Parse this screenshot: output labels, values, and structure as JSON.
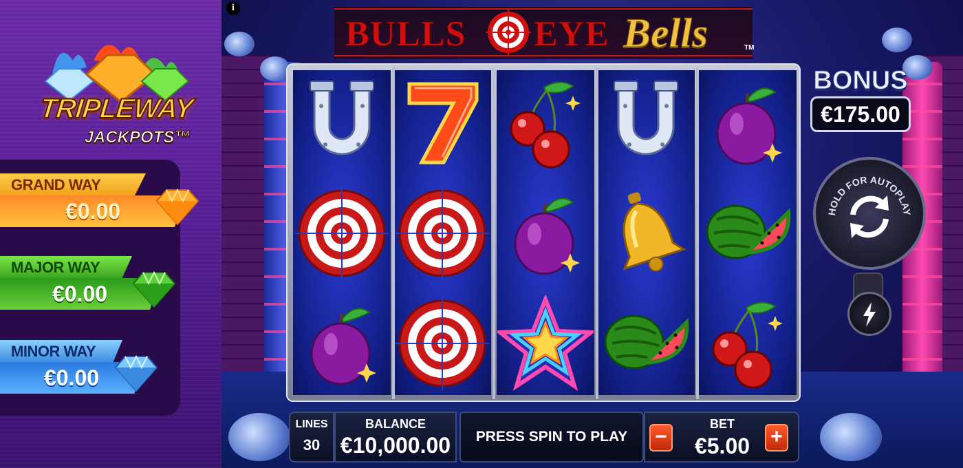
{
  "jackpots": {
    "logo_title": "TRIPLEWAY",
    "logo_sub": "JACKPOTS™",
    "grand": {
      "label": "GRAND WAY",
      "value": "€0.00"
    },
    "major": {
      "label": "MAJOR WAY",
      "value": "€0.00"
    },
    "minor": {
      "label": "MINOR WAY",
      "value": "€0.00"
    }
  },
  "info_button": "i",
  "game_title": {
    "part1": "BULLS",
    "part2": "EYE",
    "part3": "Bells",
    "tm": "TM"
  },
  "reels": [
    [
      "horseshoe",
      "target",
      "plum"
    ],
    [
      "seven",
      "target",
      "target"
    ],
    [
      "cherries",
      "plum",
      "star"
    ],
    [
      "horseshoe",
      "bell",
      "watermelon"
    ],
    [
      "plum",
      "watermelon",
      "cherries"
    ]
  ],
  "bonus": {
    "label": "BONUS",
    "value": "€175.00"
  },
  "autoplay": {
    "label": "HOLD FOR AUTOPLAY"
  },
  "bottom_bar": {
    "lines_label": "LINES",
    "lines_value": "30",
    "balance_label": "BALANCE",
    "balance_value": "€10,000.00",
    "spin_prompt": "PRESS SPIN TO PLAY",
    "bet_label": "BET",
    "bet_value": "€5.00",
    "minus": "−",
    "plus": "+"
  },
  "colors": {
    "title_red": "#d01010",
    "title_gold": "#f0c040",
    "reel_blue": "#13208a",
    "grand": "#ffc23a",
    "major": "#6ad03a",
    "minor": "#5ab0ff"
  }
}
